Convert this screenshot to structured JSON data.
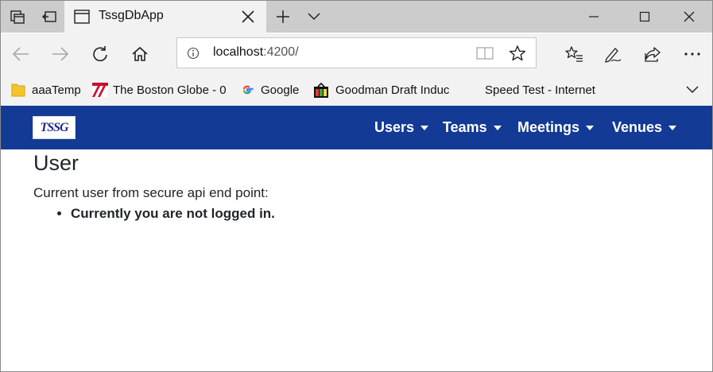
{
  "browser": {
    "tab": {
      "title": "TssgDbApp"
    },
    "address": {
      "host": "localhost",
      "port_path": ":4200/"
    },
    "favorites": [
      {
        "label": "aaaTemp",
        "icon": "folder-icon"
      },
      {
        "label": "The Boston Globe - 0",
        "icon": "boston-globe-icon"
      },
      {
        "label": "Google",
        "icon": "google-icon"
      },
      {
        "label": "Goodman Draft Induc",
        "icon": "goodman-icon"
      },
      {
        "label": "Speed Test - Internet",
        "icon": "none"
      }
    ]
  },
  "app": {
    "logo_text": "TSSG",
    "menu": [
      {
        "label": "Users"
      },
      {
        "label": "Teams"
      },
      {
        "label": "Meetings"
      },
      {
        "label": "Venues"
      }
    ],
    "accent_color": "#133a95"
  },
  "page": {
    "title": "User",
    "description": "Current user from secure api end point:",
    "messages": [
      "Currently you are not logged in."
    ]
  }
}
